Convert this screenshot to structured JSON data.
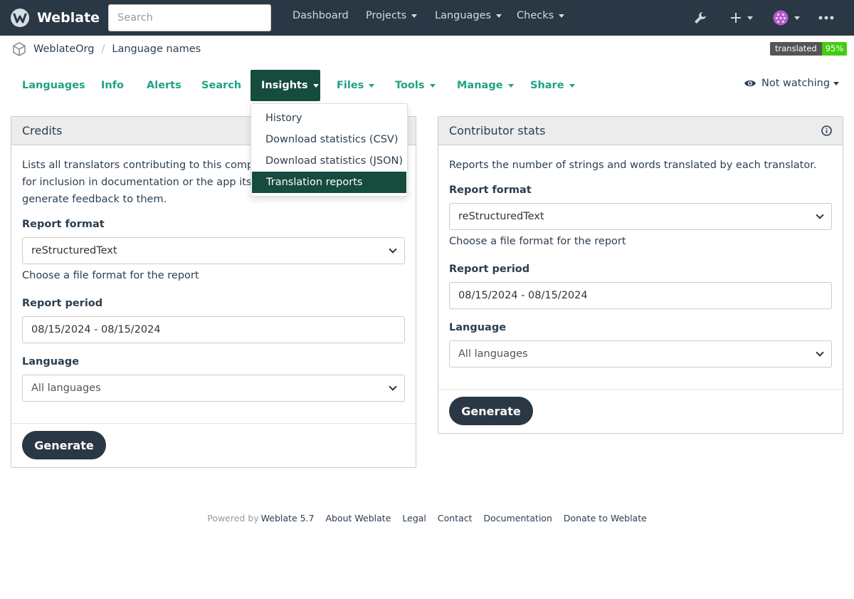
{
  "navbar": {
    "brand": "Weblate",
    "search_placeholder": "Search",
    "links": [
      "Dashboard",
      "Projects",
      "Languages",
      "Checks"
    ]
  },
  "breadcrumb": {
    "project": "WeblateOrg",
    "component": "Language names"
  },
  "badge": {
    "label": "translated",
    "value": "95%"
  },
  "tabs": [
    "Languages",
    "Info",
    "Alerts",
    "Search",
    "Insights",
    "Files",
    "Tools",
    "Manage",
    "Share"
  ],
  "watch_label": "Not watching",
  "insights_menu": [
    "History",
    "Download statistics (CSV)",
    "Download statistics (JSON)",
    "Translation reports"
  ],
  "credits": {
    "title": "Credits",
    "description_lines": [
      "Lists all translators contributing to this compone",
      "for inclusion in documentation or the app itself, t",
      "generate feedback to them."
    ],
    "format_label": "Report format",
    "format_value": "reStructuredText",
    "format_help": "Choose a file format for the report",
    "period_label": "Report period",
    "period_value": "08/15/2024 - 08/15/2024",
    "language_label": "Language",
    "language_value": "All languages",
    "button": "Generate"
  },
  "contributor": {
    "title": "Contributor stats",
    "description": "Reports the number of strings and words translated by each translator.",
    "format_label": "Report format",
    "format_value": "reStructuredText",
    "format_help": "Choose a file format for the report",
    "period_label": "Report period",
    "period_value": "08/15/2024 - 08/15/2024",
    "language_label": "Language",
    "language_value": "All languages",
    "button": "Generate"
  },
  "footer": {
    "powered_by": "Powered by",
    "version": "Weblate 5.7",
    "links": [
      "About Weblate",
      "Legal",
      "Contact",
      "Documentation",
      "Donate to Weblate"
    ]
  },
  "colors": {
    "navbar": "#2a3744",
    "accent": "#1fa385",
    "active_tab": "#154c3d",
    "badge_green": "#44cc11"
  }
}
